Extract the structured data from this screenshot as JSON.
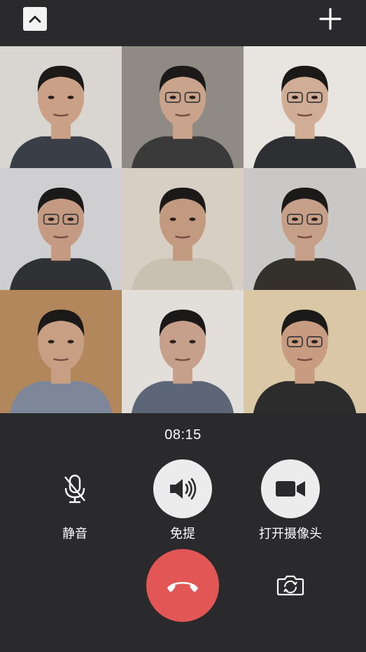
{
  "header": {
    "collapse_icon": "chevron-up-icon",
    "add_icon": "plus-icon"
  },
  "participants": [
    {
      "bg": "#d9d6d2",
      "skin": "#caa086",
      "shirt": "#3a3e46",
      "glasses": false
    },
    {
      "bg": "#8f8a84",
      "skin": "#c9a38c",
      "shirt": "#3b3a3a",
      "glasses": true
    },
    {
      "bg": "#e8e4e0",
      "skin": "#d1ad95",
      "shirt": "#2e2f33",
      "glasses": true
    },
    {
      "bg": "#cfcfd1",
      "skin": "#c49a82",
      "shirt": "#2f3134",
      "glasses": true
    },
    {
      "bg": "#d8cfc4",
      "skin": "#c29a80",
      "shirt": "#c9c0b1",
      "glasses": false
    },
    {
      "bg": "#c9c8c6",
      "skin": "#c59f88",
      "shirt": "#34302c",
      "glasses": true
    },
    {
      "bg": "#b2875c",
      "skin": "#c99f84",
      "shirt": "#7e8799",
      "glasses": false
    },
    {
      "bg": "#e2dfdb",
      "skin": "#c6a08a",
      "shirt": "#5d6676",
      "glasses": false
    },
    {
      "bg": "#d9c7a5",
      "skin": "#c79c80",
      "shirt": "#2d2c2c",
      "glasses": true
    }
  ],
  "call": {
    "timer": "08:15",
    "mute_label": "静音",
    "speaker_label": "免提",
    "camera_label": "打开摄像头",
    "mute_icon": "microphone-muted-icon",
    "speaker_icon": "speaker-icon",
    "camera_icon": "video-camera-icon",
    "hangup_icon": "phone-hangup-icon",
    "flip_icon": "camera-switch-icon"
  },
  "colors": {
    "background": "#2a2a2c",
    "hangup": "#e35656",
    "control_fill": "#ececec"
  }
}
